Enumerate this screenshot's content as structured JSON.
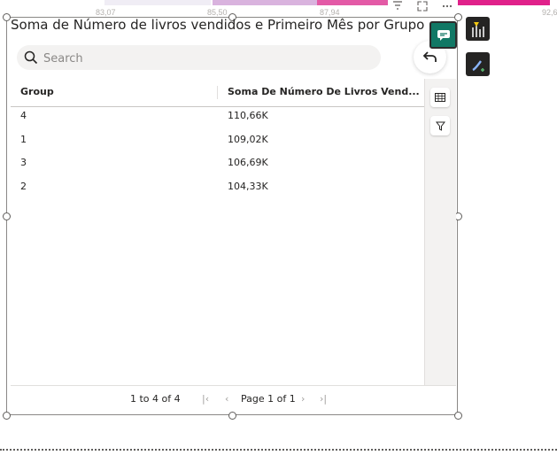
{
  "top_axis_ticks": [
    "83,07",
    "85,50",
    "87,94",
    "92,6"
  ],
  "top_bar_colors": [
    "#e9e4f2",
    "#d9b3de",
    "#e35aa6",
    "#e0218a"
  ],
  "visual": {
    "title": "Soma de Número de livros vendidos e Primeiro Mês por Grupo",
    "search_placeholder": "Search",
    "back_icon": "undo-arrow-icon"
  },
  "table": {
    "columns": [
      "Group",
      "Soma De Número De Livros Vend..."
    ],
    "rows": [
      {
        "group": "4",
        "value": "110,66K"
      },
      {
        "group": "1",
        "value": "109,02K"
      },
      {
        "group": "3",
        "value": "106,69K"
      },
      {
        "group": "2",
        "value": "104,33K"
      }
    ]
  },
  "footer": {
    "range": "1 to 4 of 4",
    "page": "Page 1 of 1"
  },
  "side_toolbar": {
    "icons": [
      "copilot-chat-icon",
      "format-visual-icon",
      "analytics-brush-icon"
    ],
    "accent": "#117865"
  }
}
